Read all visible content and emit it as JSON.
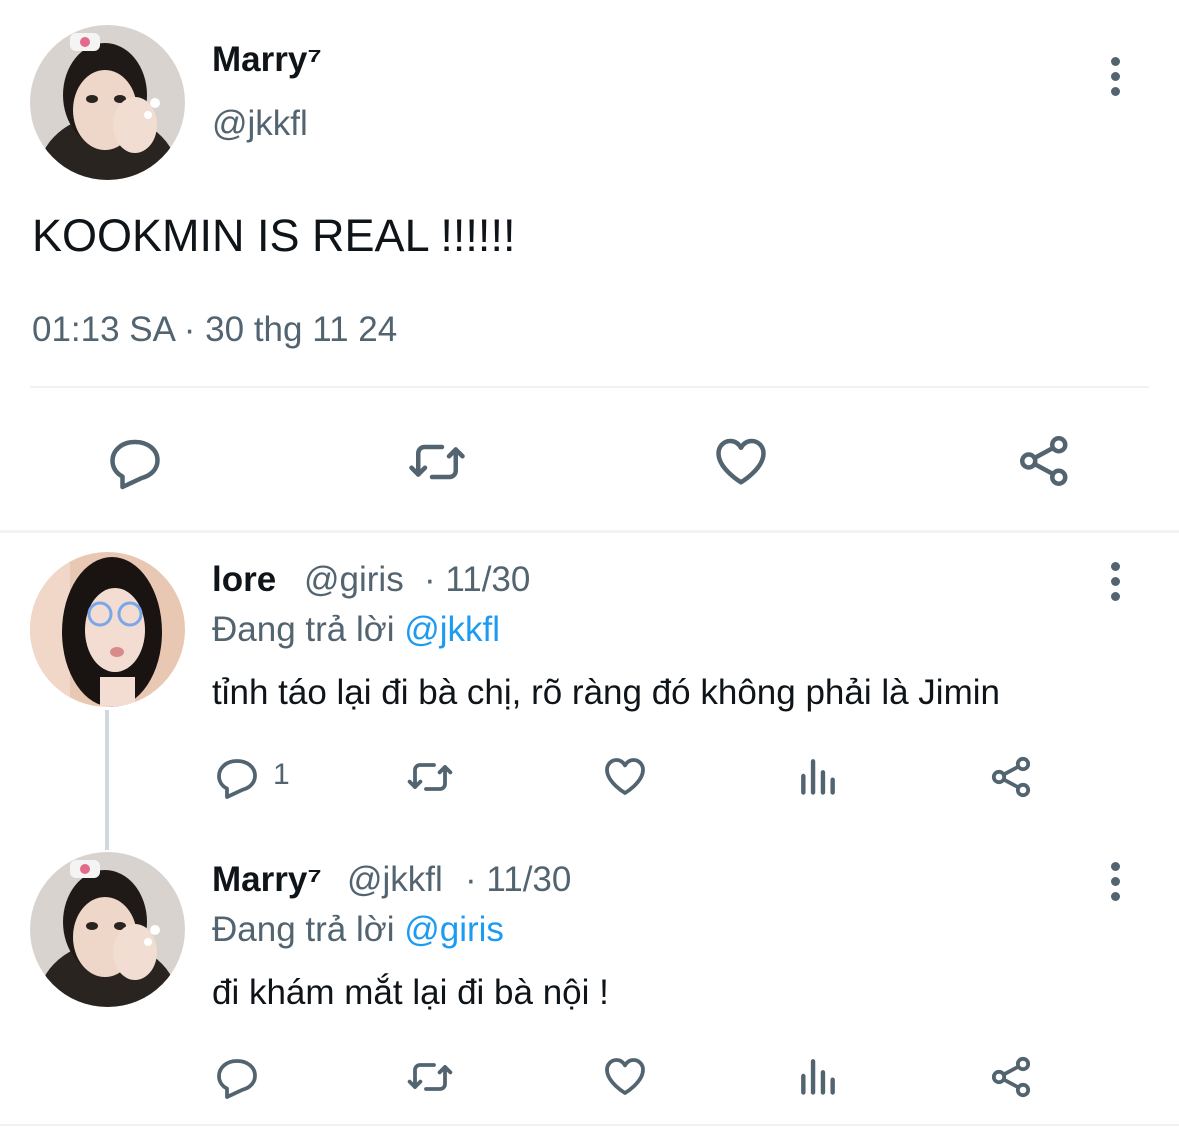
{
  "main_tweet": {
    "display_name": "Marry⁷",
    "handle": "@jkkfl",
    "text": "KOOKMIN IS REAL !!!!!!",
    "timestamp": "01:13 SA · 30 thg 11 24",
    "actions": [
      "reply-icon",
      "retweet-icon",
      "like-icon",
      "share-icon"
    ]
  },
  "replies": [
    {
      "display_name": "lore",
      "handle": "@giris",
      "date": "· 11/30",
      "replying_prefix": "Đang trả lời",
      "replying_to": "@jkkfl",
      "text": "tỉnh táo lại đi bà chị, rõ ràng đó không phải là Jimin",
      "reply_count": "1",
      "actions": [
        "reply-icon",
        "retweet-icon",
        "like-icon",
        "views-icon",
        "share-icon"
      ]
    },
    {
      "display_name": "Marry⁷",
      "handle": "@jkkfl",
      "date": "· 11/30",
      "replying_prefix": "Đang trả lời",
      "replying_to": "@giris",
      "text": "đi khám mắt lại đi bà nội !",
      "reply_count": "",
      "actions": [
        "reply-icon",
        "retweet-icon",
        "like-icon",
        "views-icon",
        "share-icon"
      ]
    }
  ],
  "colors": {
    "text": "#0f1419",
    "muted": "#536471",
    "link": "#1d9bf0",
    "divider": "#eff3f4"
  }
}
